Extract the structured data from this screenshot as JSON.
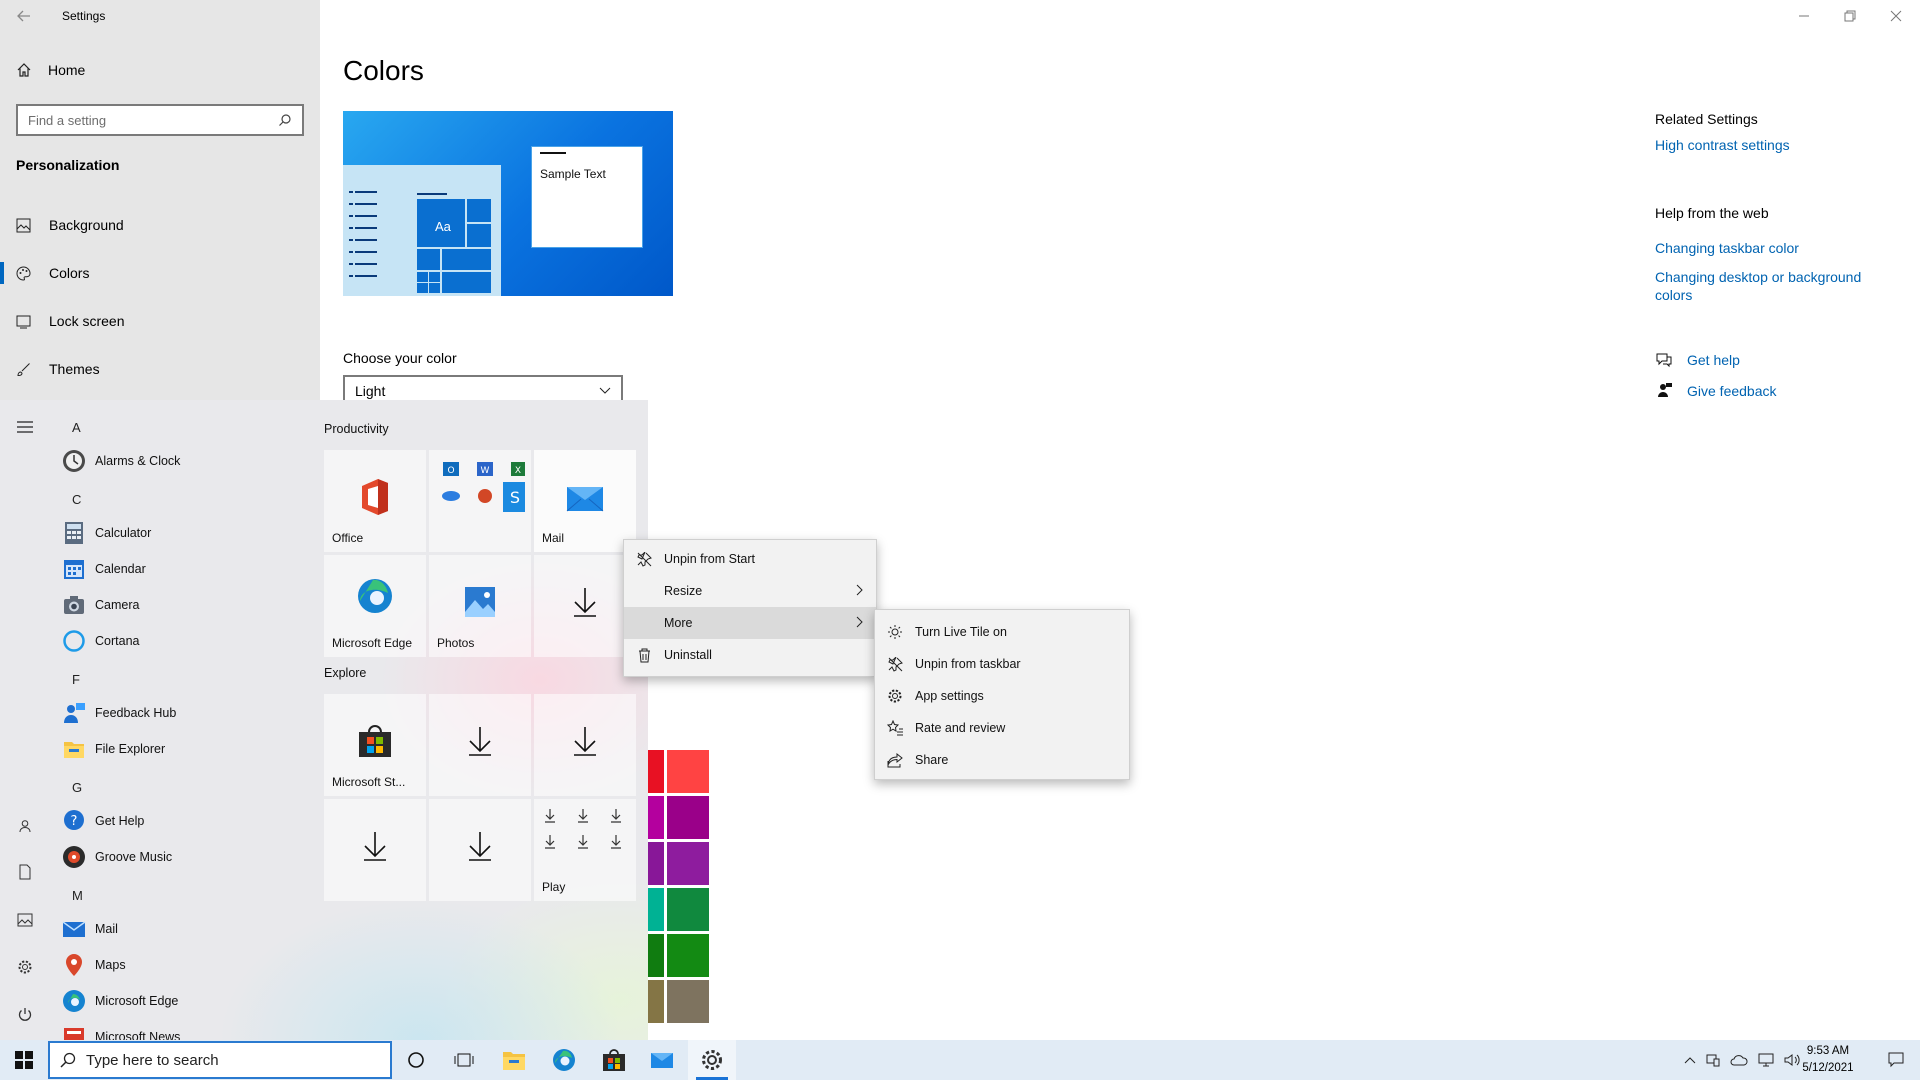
{
  "window": {
    "title": "Settings"
  },
  "sidebar": {
    "home": "Home",
    "search_placeholder": "Find a setting",
    "section": "Personalization",
    "items": [
      {
        "label": "Background",
        "icon": "image-icon"
      },
      {
        "label": "Colors",
        "icon": "palette-icon"
      },
      {
        "label": "Lock screen",
        "icon": "lock-screen-icon"
      },
      {
        "label": "Themes",
        "icon": "brush-icon"
      }
    ]
  },
  "main": {
    "title": "Colors",
    "preview_sample_text": "Sample Text",
    "preview_tile_text": "Aa",
    "choose_label": "Choose your color",
    "choose_value": "Light"
  },
  "related": {
    "title": "Related Settings",
    "high_contrast": "High contrast settings",
    "help_title": "Help from the web",
    "link1": "Changing taskbar color",
    "link2": "Changing desktop or background colors",
    "get_help": "Get help",
    "give_feedback": "Give feedback"
  },
  "start": {
    "letters": [
      "A",
      "C",
      "F",
      "G",
      "M"
    ],
    "apps": [
      "Alarms & Clock",
      "Calculator",
      "Calendar",
      "Camera",
      "Cortana",
      "Feedback Hub",
      "File Explorer",
      "Get Help",
      "Groove Music",
      "Mail",
      "Maps",
      "Microsoft Edge",
      "Microsoft News"
    ],
    "groups": {
      "productivity": "Productivity",
      "explore": "Explore"
    },
    "tiles": {
      "office": "Office",
      "mail": "Mail",
      "edge": "Microsoft Edge",
      "photos": "Photos",
      "store": "Microsoft St...",
      "play": "Play"
    }
  },
  "context_menu": {
    "unpin_start": "Unpin from Start",
    "resize": "Resize",
    "more": "More",
    "uninstall": "Uninstall"
  },
  "submenu": {
    "live_tile": "Turn Live Tile on",
    "unpin_taskbar": "Unpin from taskbar",
    "app_settings": "App settings",
    "rate": "Rate and review",
    "share": "Share"
  },
  "taskbar": {
    "search_placeholder": "Type here to search",
    "time": "9:53 AM",
    "date": "5/12/2021"
  },
  "colors": {
    "accent": "#0067c0",
    "link": "#0063b1",
    "swatches": [
      "#e81123",
      "#ff4343",
      "#b4009e",
      "#9a0089",
      "#881798",
      "#8e1c9e",
      "#00b294",
      "#10893e",
      "#107c10",
      "#138a13",
      "#7e735f",
      "#847545"
    ]
  }
}
